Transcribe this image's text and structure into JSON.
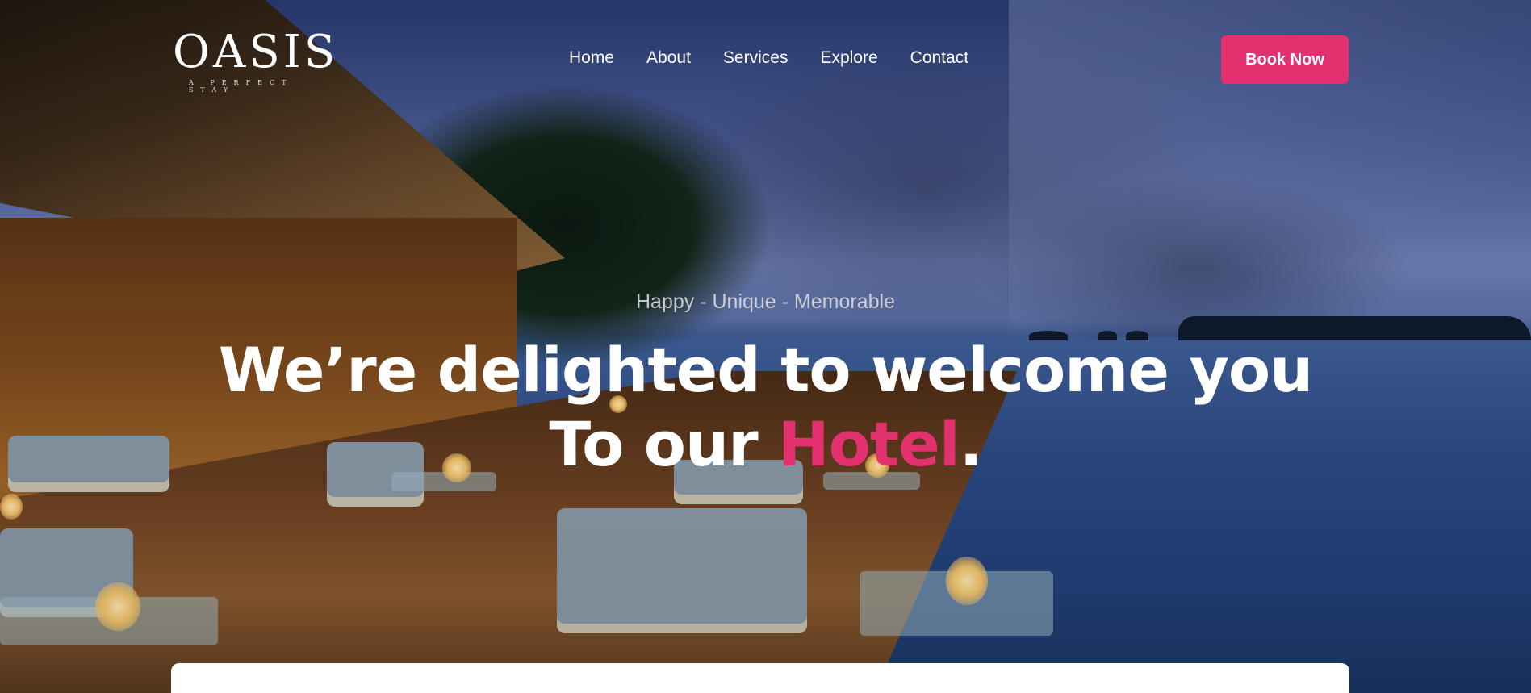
{
  "brand": {
    "logo_text": "OASIS",
    "tagline": "A PERFECT STAY"
  },
  "nav": {
    "items": [
      {
        "label": "Home"
      },
      {
        "label": "About"
      },
      {
        "label": "Services"
      },
      {
        "label": "Explore"
      },
      {
        "label": "Contact"
      }
    ]
  },
  "header": {
    "cta_label": "Book Now"
  },
  "hero": {
    "subtitle": "Happy - Unique - Memorable",
    "headline_line1": "We’re delighted to welcome you",
    "headline_line2_prefix": "To our ",
    "headline_line2_accent": "Hotel",
    "headline_line2_suffix": "."
  },
  "colors": {
    "accent": "#e3306e",
    "text": "#ffffff"
  }
}
